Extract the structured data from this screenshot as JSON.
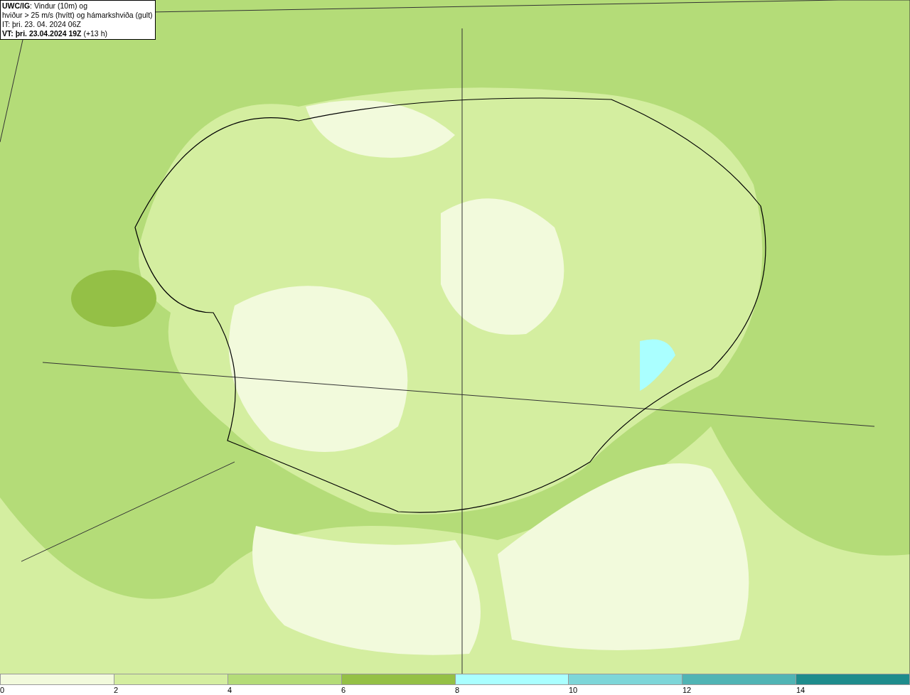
{
  "map": {
    "title_lines": [
      "**UWC/IG**: Vindur (10m) og",
      "hviður > 25 m/s (hvítt) og hámarkshviða (gult)",
      "IT: þri. 23. 04. 2024 06Z",
      "**VT: þri. 23.04.2024 19Z** (+13 h)"
    ]
  },
  "legend": {
    "swatches": [
      {
        "color": "#f2fadc"
      },
      {
        "color": "#d4eea0"
      },
      {
        "color": "#b4dc78"
      },
      {
        "color": "#94c046"
      },
      {
        "color": "#aaffff"
      },
      {
        "color": "#7dd6d8"
      },
      {
        "color": "#50b4b4"
      },
      {
        "color": "#1e8c8c"
      }
    ],
    "ticks": [
      "0",
      "2",
      "4",
      "6",
      "8",
      "10",
      "12",
      "14"
    ]
  }
}
